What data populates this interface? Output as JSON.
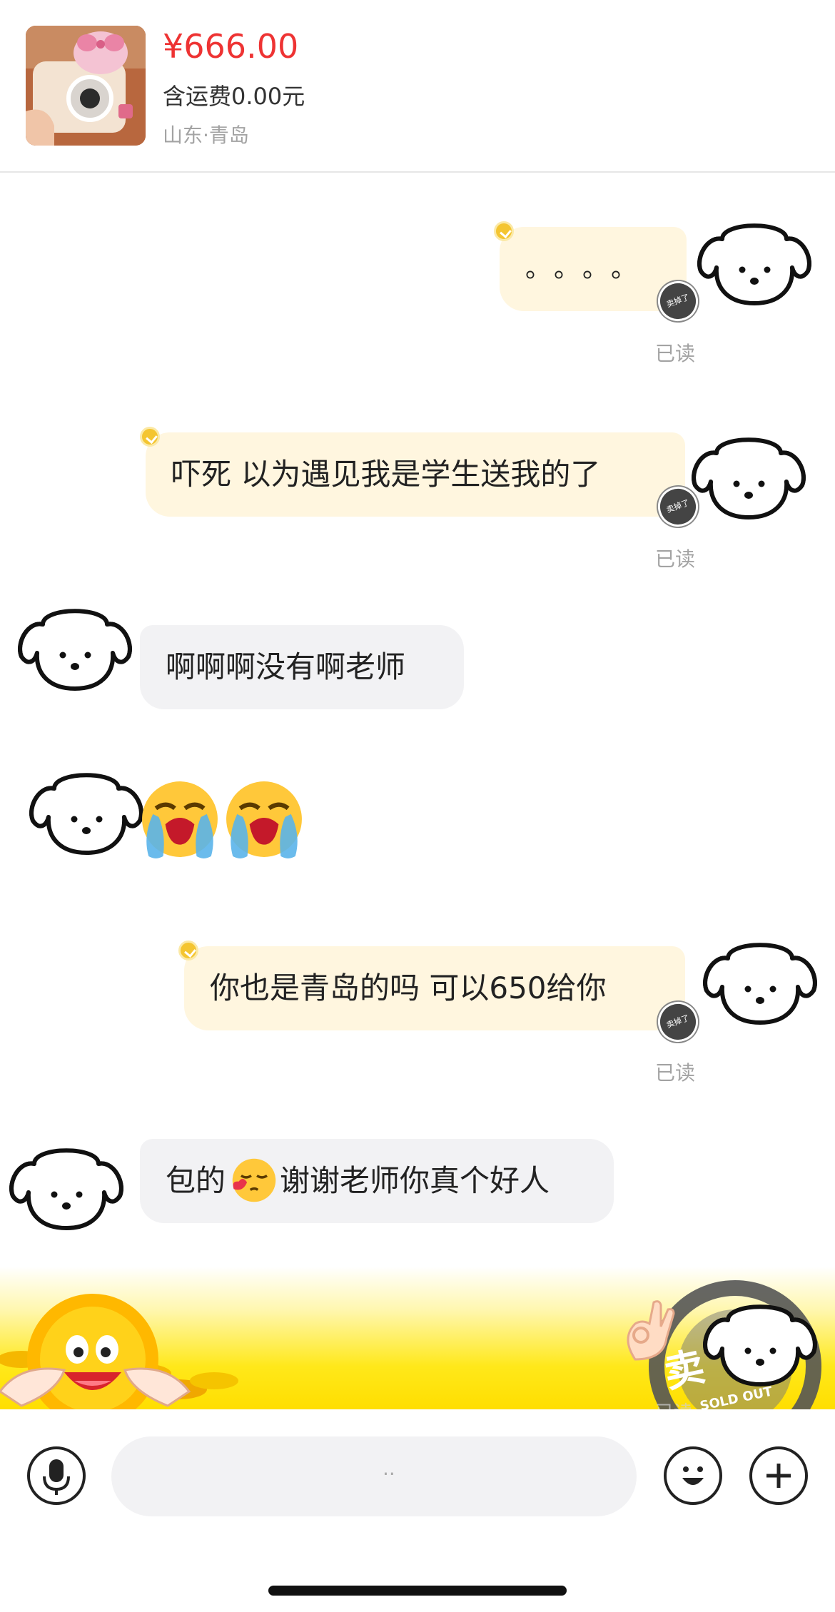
{
  "product": {
    "price": "¥666.00",
    "shipping": "含运费0.00元",
    "location": "山东·青岛",
    "thumbnail_icon": "hello-kitty-instax-camera-photo"
  },
  "messages": [
    {
      "side": "mine",
      "text": "。。。。",
      "read": "已读"
    },
    {
      "side": "mine",
      "text": "吓死 以为遇见我是学生送我的了",
      "read": "已读"
    },
    {
      "side": "theirs",
      "text": "啊啊啊没有啊老师"
    },
    {
      "side": "theirs",
      "emoji": [
        "loudly-crying-face-icon",
        "loudly-crying-face-icon"
      ]
    },
    {
      "side": "mine",
      "text": "你也是青岛的吗 可以650给你",
      "read": "已读"
    },
    {
      "side": "theirs",
      "text_before": "包的",
      "inline_emoji": "blowing-kiss-face-icon",
      "text_after": "谢谢老师你真个好人"
    }
  ],
  "seller_badge": "卖掉了",
  "banner": {
    "stamp_main": "卖",
    "stamp_sub": "SOLD OUT",
    "stamp_faded": "已读"
  },
  "inputbar": {
    "voice_icon": "microphone-icon",
    "emoji_icon": "smiley-icon",
    "plus_icon": "plus-icon",
    "placeholder": ".."
  },
  "colors": {
    "price": "#ee3333",
    "mine_bubble": "#fff6df",
    "theirs_bubble": "#f2f2f4",
    "banner_yellow": "#ffe81a"
  }
}
